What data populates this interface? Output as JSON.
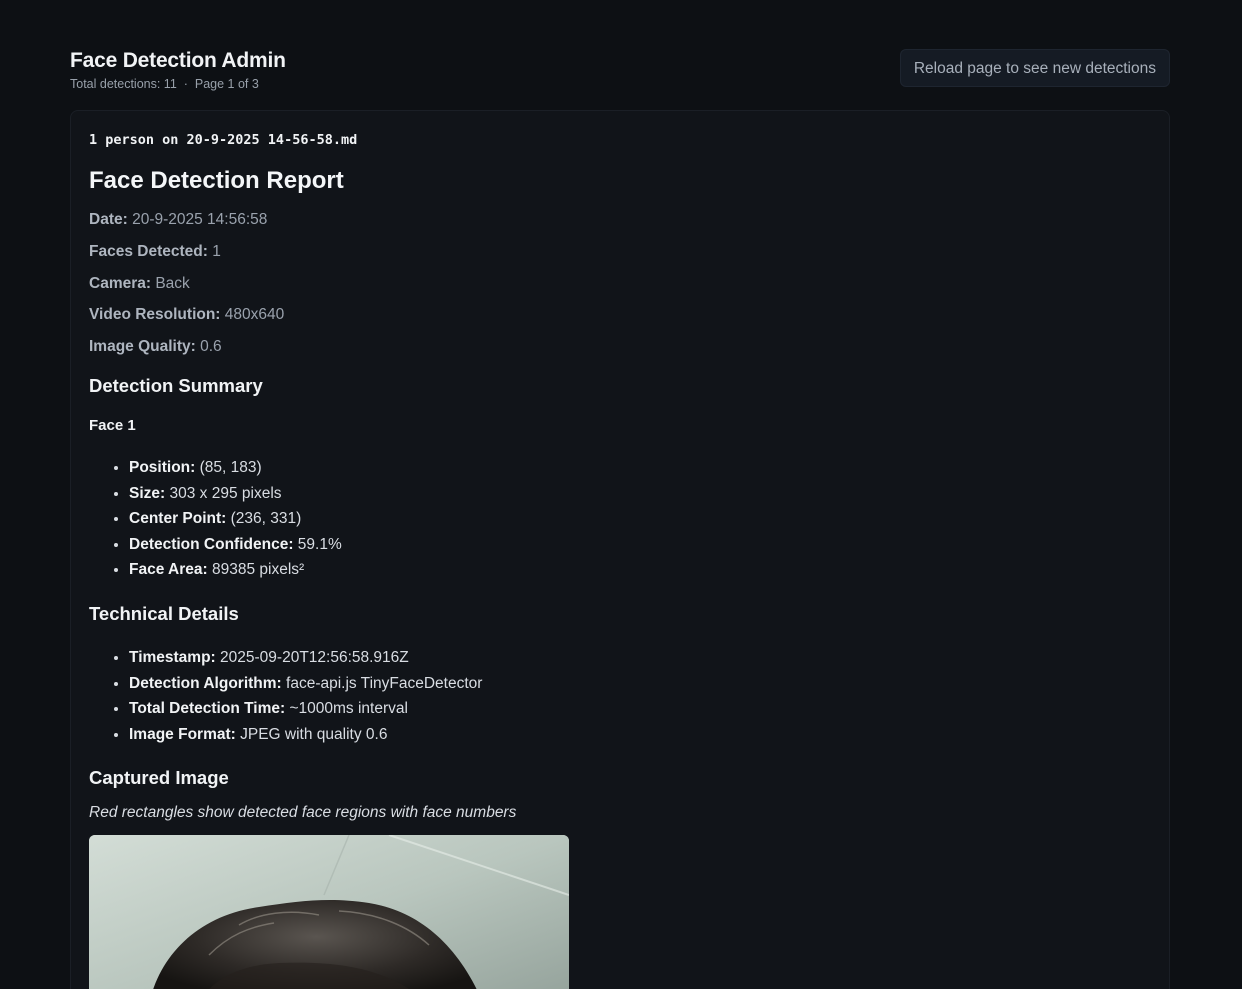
{
  "header": {
    "title": "Face Detection Admin",
    "total_detections": "Total detections: 11",
    "separator": "·",
    "page_info": "Page 1 of 3",
    "reload_label": "Reload page to see new detections"
  },
  "report": {
    "filename": "1 person on 20-9-2025 14-56-58.md",
    "title": "Face Detection Report",
    "meta": [
      {
        "label": "Date:",
        "value": "20-9-2025 14:56:58"
      },
      {
        "label": "Faces Detected:",
        "value": "1"
      },
      {
        "label": "Camera:",
        "value": "Back"
      },
      {
        "label": "Video Resolution:",
        "value": "480x640"
      },
      {
        "label": "Image Quality:",
        "value": "0.6"
      }
    ],
    "summary_heading": "Detection Summary",
    "face_heading": "Face 1",
    "face_props": [
      {
        "label": "Position:",
        "value": "(85, 183)"
      },
      {
        "label": "Size:",
        "value": "303 x 295 pixels"
      },
      {
        "label": "Center Point:",
        "value": "(236, 331)"
      },
      {
        "label": "Detection Confidence:",
        "value": "59.1%"
      },
      {
        "label": "Face Area:",
        "value": "89385 pixels²"
      }
    ],
    "technical_heading": "Technical Details",
    "technical_props": [
      {
        "label": "Timestamp:",
        "value": "2025-09-20T12:56:58.916Z"
      },
      {
        "label": "Detection Algorithm:",
        "value": "face-api.js TinyFaceDetector"
      },
      {
        "label": "Total Detection Time:",
        "value": "~1000ms interval"
      },
      {
        "label": "Image Format:",
        "value": "JPEG with quality 0.6"
      }
    ],
    "image_heading": "Captured Image",
    "image_caption": "Red rectangles show detected face regions with face numbers"
  }
}
